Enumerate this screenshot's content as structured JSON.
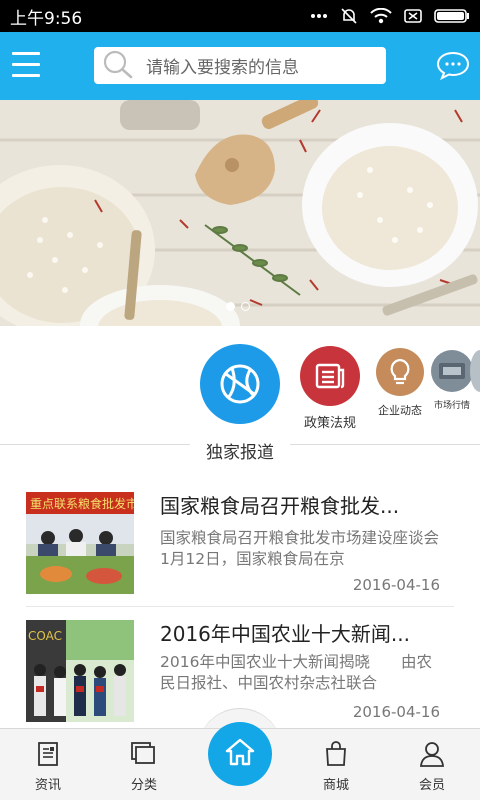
{
  "status_bar": {
    "time": "上午9:56"
  },
  "header": {
    "search_placeholder": "请输入要搜索的信息"
  },
  "categories": [
    {
      "label": "独家报道",
      "color": "#1e9be8"
    },
    {
      "label": "政策法规",
      "color": "#c8343b"
    },
    {
      "label": "企业动态",
      "color": "#c58b5a"
    },
    {
      "label": "市场行情",
      "color": "#7f8d99"
    }
  ],
  "news": [
    {
      "title": "国家粮食局召开粮食批发...",
      "desc": "国家粮食局召开粮食批发市场建设座谈会　　1月12日，国家粮食局在京",
      "date": "2016-04-16",
      "thumb_text": "重点联系粮食批发市"
    },
    {
      "title": "2016年中国农业十大新闻...",
      "desc": "2016年中国农业十大新闻揭晓　　由农民日报社、中国农村杂志社联合",
      "date": "2016-04-16",
      "thumb_text": "COAC"
    }
  ],
  "tabs": [
    {
      "label": "资讯"
    },
    {
      "label": "分类"
    },
    {
      "label": "商城"
    },
    {
      "label": "会员"
    }
  ]
}
